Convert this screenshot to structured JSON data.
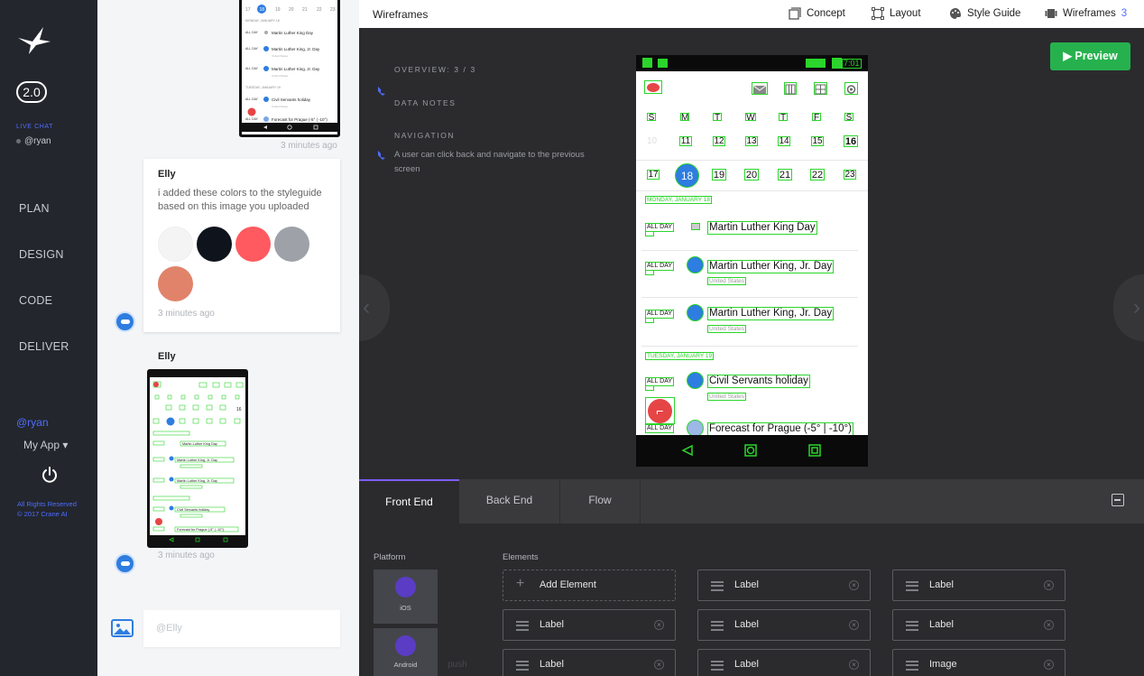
{
  "nav": {
    "version": "2.0",
    "live_chat": "LIVE CHAT",
    "chat_user": "@ryan",
    "items": [
      "PLAN",
      "DESIGN",
      "CODE",
      "DELIVER"
    ],
    "user": "@ryan",
    "app": "My App ▾",
    "footer1": "All Rights Reserved",
    "footer2": "© 2017 Crane AI"
  },
  "chat": {
    "ts1": "3 minutes ago",
    "msg": {
      "author": "Elly",
      "text": "i added these colors to the styleguide based on this image you uploaded",
      "ts": "3 minutes ago",
      "colors": [
        "#f4f4f4",
        "#0f141c",
        "#ff5a5f",
        "#9ea2a8",
        "#e0836a"
      ]
    },
    "msg2": {
      "author": "Elly",
      "ts": "3 minutes ago"
    },
    "input_placeholder": "@Elly"
  },
  "main": {
    "title": "Wireframes",
    "menu": [
      {
        "label": "Concept"
      },
      {
        "label": "Layout"
      },
      {
        "label": "Style Guide"
      },
      {
        "label": "Wireframes",
        "count": "3"
      }
    ],
    "preview": "▶ Preview",
    "overview": "OVERVIEW: 3 / 3",
    "data_notes": "DATA NOTES",
    "navigation": "NAVIGATION",
    "nav_note": "A user can click back and navigate to the previous screen"
  },
  "phone": {
    "time": "7:01",
    "week_letters": [
      "S",
      "M",
      "T",
      "W",
      "T",
      "F",
      "S"
    ],
    "week1": [
      "10",
      "11",
      "12",
      "13",
      "14",
      "15",
      "16"
    ],
    "week2": [
      "17",
      "18",
      "19",
      "20",
      "21",
      "22",
      "23"
    ],
    "day1": "MONDAY, JANUARY 18",
    "day2": "TUESDAY, JANUARY 19",
    "events": [
      {
        "tag": "ALL DAY",
        "title": "Martin Luther King Day",
        "sub": ""
      },
      {
        "tag": "ALL DAY",
        "title": "Martin Luther King, Jr. Day",
        "sub": "United States"
      },
      {
        "tag": "ALL DAY",
        "title": "Martin Luther King, Jr. Day",
        "sub": "United States"
      },
      {
        "tag": "ALL DAY",
        "title": "Civil Servants holiday",
        "sub": "United States"
      },
      {
        "tag": "ALL DAY",
        "title": "Forecast for Prague (-5° | -10°)",
        "sub": ""
      }
    ]
  },
  "panel": {
    "tabs": [
      "Front End",
      "Back End",
      "Flow"
    ],
    "platform_label": "Platform",
    "elements_label": "Elements",
    "platforms": [
      "iOS",
      "Android"
    ],
    "push": "push",
    "elements": [
      "Add Element",
      "Label",
      "Label",
      "Label",
      "Label",
      "Label",
      "Label",
      "Label",
      "Image"
    ]
  }
}
